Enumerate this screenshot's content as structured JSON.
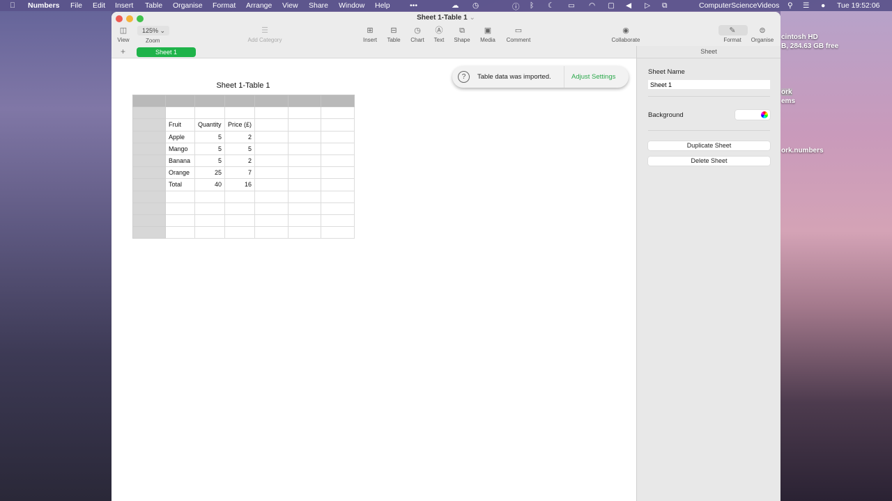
{
  "menubar": {
    "app": "Numbers",
    "items": [
      "File",
      "Edit",
      "Insert",
      "Table",
      "Organise",
      "Format",
      "Arrange",
      "View",
      "Share",
      "Window",
      "Help"
    ],
    "user": "ComputerScienceVideos",
    "clock": "Tue  19:52:06"
  },
  "desktop": {
    "disk_name": "cintosh HD",
    "disk_info": "B, 284.63 GB free",
    "folder": "ork",
    "folder_sub": "ems",
    "file": "ork.numbers"
  },
  "window": {
    "title": "Sheet 1-Table 1"
  },
  "toolbar": {
    "view": "View",
    "zoom_value": "125%",
    "zoom": "Zoom",
    "add_category": "Add Category",
    "insert": "Insert",
    "table": "Table",
    "chart": "Chart",
    "text": "Text",
    "shape": "Shape",
    "media": "Media",
    "comment": "Comment",
    "collaborate": "Collaborate",
    "format": "Format",
    "organise": "Organise"
  },
  "tabs": {
    "add": "+",
    "sheet": "Sheet 1"
  },
  "toast": {
    "message": "Table data was imported.",
    "action": "Adjust Settings",
    "accent": "#2aa84a"
  },
  "table": {
    "title": "Sheet 1-Table 1",
    "rows": [
      [
        "",
        "",
        ""
      ],
      [
        "Fruit",
        "Quantity",
        "Price (£)"
      ],
      [
        "Apple",
        "5",
        "2"
      ],
      [
        "Mango",
        "5",
        "5"
      ],
      [
        "Banana",
        "5",
        "2"
      ],
      [
        "Orange",
        "25",
        "7"
      ],
      [
        "Total",
        "40",
        "16"
      ],
      [
        "",
        "",
        ""
      ],
      [
        "",
        "",
        ""
      ],
      [
        "",
        "",
        ""
      ],
      [
        "",
        "",
        ""
      ]
    ]
  },
  "sidebar": {
    "header": "Sheet",
    "sheet_name_label": "Sheet Name",
    "sheet_name_value": "Sheet 1",
    "background_label": "Background",
    "duplicate": "Duplicate Sheet",
    "delete": "Delete Sheet"
  }
}
